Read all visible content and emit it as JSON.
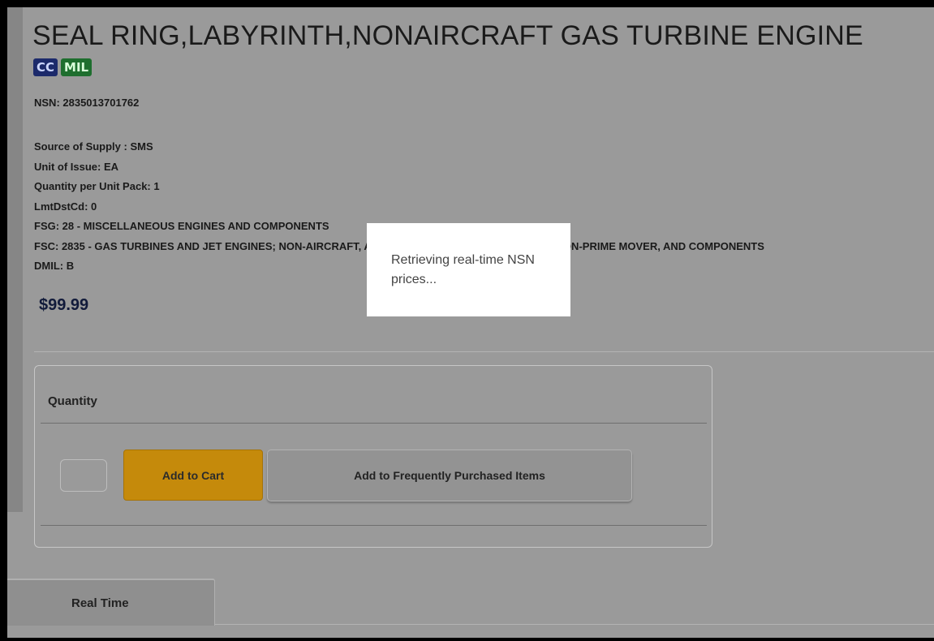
{
  "product": {
    "title": "SEAL RING,LABYRINTH,NONAIRCRAFT GAS TURBINE ENGINE",
    "badges": {
      "cc": "CC",
      "mil": "MIL"
    },
    "nsn": "NSN: 2835013701762",
    "details": {
      "source_of_supply": "Source of Supply : SMS",
      "unit_of_issue": "Unit of Issue: EA",
      "quantity_per_unit_pack": "Quantity per Unit Pack: 1",
      "lmt_dst_cd": "LmtDstCd: 0",
      "fsg": "FSG: 28 - MISCELLANEOUS ENGINES AND COMPONENTS",
      "fsc": "FSC: 2835 - GAS TURBINES AND JET ENGINES; NON-AIRCRAFT, AND COMPONENTS; NON-AIRCRAFT NON-PRIME MOVER, AND COMPONENTS",
      "dmil": "DMIL: B"
    },
    "price": "$99.99"
  },
  "quantity_panel": {
    "label": "Quantity",
    "input_value": "",
    "add_to_cart_label": "Add to Cart",
    "add_to_frequent_label": "Add to Frequently Purchased Items"
  },
  "tabs": [
    {
      "label": "Real Time"
    }
  ],
  "loading_modal": {
    "message": "Retrieving real-time NSN prices..."
  },
  "colors": {
    "overlay_gray": "#9a9a9a",
    "cart_button": "#c58a0b",
    "badge_cc": "#1c2a6b",
    "badge_mil": "#1e6e2e",
    "price_text": "#111a3a"
  }
}
